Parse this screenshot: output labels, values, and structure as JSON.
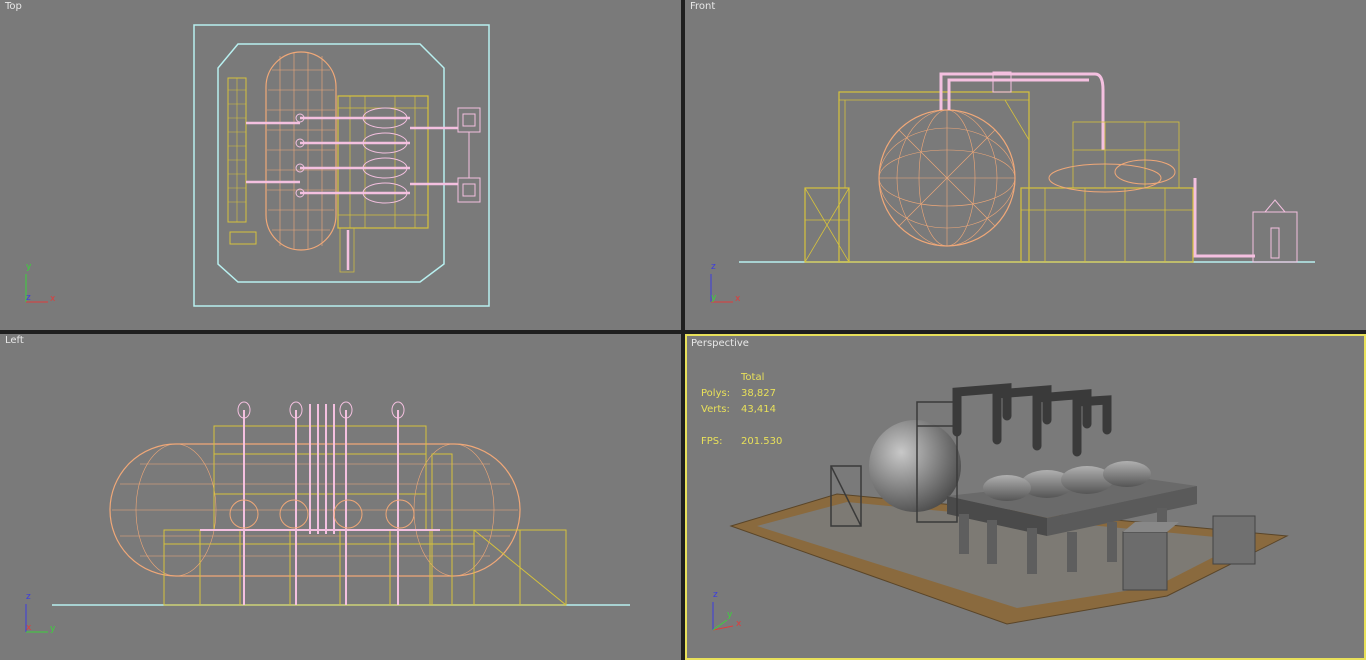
{
  "viewports": {
    "top": {
      "label": "Top"
    },
    "front": {
      "label": "Front"
    },
    "left": {
      "label": "Left"
    },
    "perspective": {
      "label": "Perspective"
    }
  },
  "stats": {
    "header": "Total",
    "polys_label": "Polys:",
    "polys_value": "38,827",
    "verts_label": "Verts:",
    "verts_value": "43,414",
    "fps_label": "FPS:",
    "fps_value": "201.530"
  },
  "axes": {
    "top": {
      "up": "y",
      "right": "x",
      "origin": "z"
    },
    "front": {
      "up": "z",
      "right": "x",
      "origin": "y"
    },
    "left": {
      "up": "z",
      "right": "y",
      "origin": "x"
    },
    "perspective": {
      "up": "z",
      "right": "x",
      "origin": "y"
    }
  },
  "colors": {
    "viewport_bg": "#7a7a7a",
    "active_border": "#e8e05a",
    "wire_steel": "#d6c23c",
    "wire_tank": "#f0a878",
    "wire_pipe": "#f4c0e0",
    "wire_ground": "#b8f0f0",
    "stats_text": "#e8e05a"
  }
}
